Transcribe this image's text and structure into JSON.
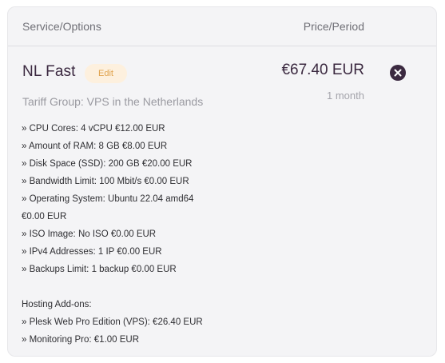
{
  "header": {
    "left_label": "Service/Options",
    "right_label": "Price/Period"
  },
  "product": {
    "name": "NL Fast",
    "edit_label": "Edit",
    "price": "€67.40 EUR",
    "period": "1 month",
    "tariff_group": "Tariff Group: VPS in the Netherlands"
  },
  "options_lines": [
    "» CPU Cores: 4 vCPU €12.00 EUR",
    "» Amount of RAM: 8 GB €8.00 EUR",
    "» Disk Space (SSD): 200 GB €20.00 EUR",
    "» Bandwidth Limit: 100 Mbit/s €0.00 EUR",
    "» Operating System: Ubuntu 22.04 amd64",
    "€0.00 EUR",
    "» ISO Image: No ISO €0.00 EUR",
    "» IPv4 Addresses: 1 IP €0.00 EUR",
    "» Backups Limit: 1 backup €0.00 EUR"
  ],
  "addons": {
    "title": "Hosting Add-ons:",
    "items": [
      "» Plesk Web Pro Edition (VPS): €26.40 EUR",
      "» Monitoring Pro: €1.00 EUR"
    ]
  },
  "icons": {
    "remove": "close-circle-icon"
  },
  "colors": {
    "accent_dark": "#3b2940",
    "edit_bg": "#fdf0de",
    "edit_text": "#e0a24c",
    "panel_bg": "#f4f4f6"
  }
}
